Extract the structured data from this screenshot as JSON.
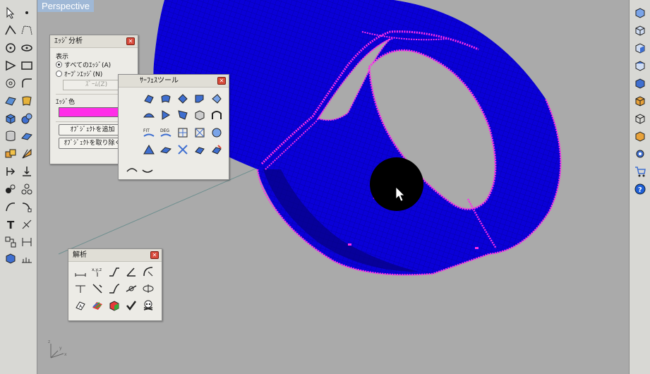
{
  "viewport": {
    "title": "Perspective"
  },
  "edge_panel": {
    "title": "ｴｯｼﾞ分析",
    "display_label": "表示",
    "radio_all": "すべてのｴｯｼﾞ(A)",
    "radio_open": "ｵｰﾌﾟﾝｴｯｼﾞ(N)",
    "radio_selected": "all",
    "zoom_label": "ｽﾞｰﾑ(Z)",
    "edge_color_label": "ｴｯｼﾞ色",
    "edge_color": "#ff2ee8",
    "add_object_label": "ｵﾌﾞｼﾞｪｸﾄを追加",
    "remove_object_label": "ｵﾌﾞｼﾞｪｸﾄを取り除く"
  },
  "surface_panel": {
    "title": "ｻｰﾌｪｽツール"
  },
  "analysis_panel": {
    "title": "解析"
  },
  "colors": {
    "model": "#0a00d8",
    "naked_edges": "#ff2ee8",
    "viewport_bg": "#aaaaaa",
    "title_bar": "#9fb8d6"
  }
}
